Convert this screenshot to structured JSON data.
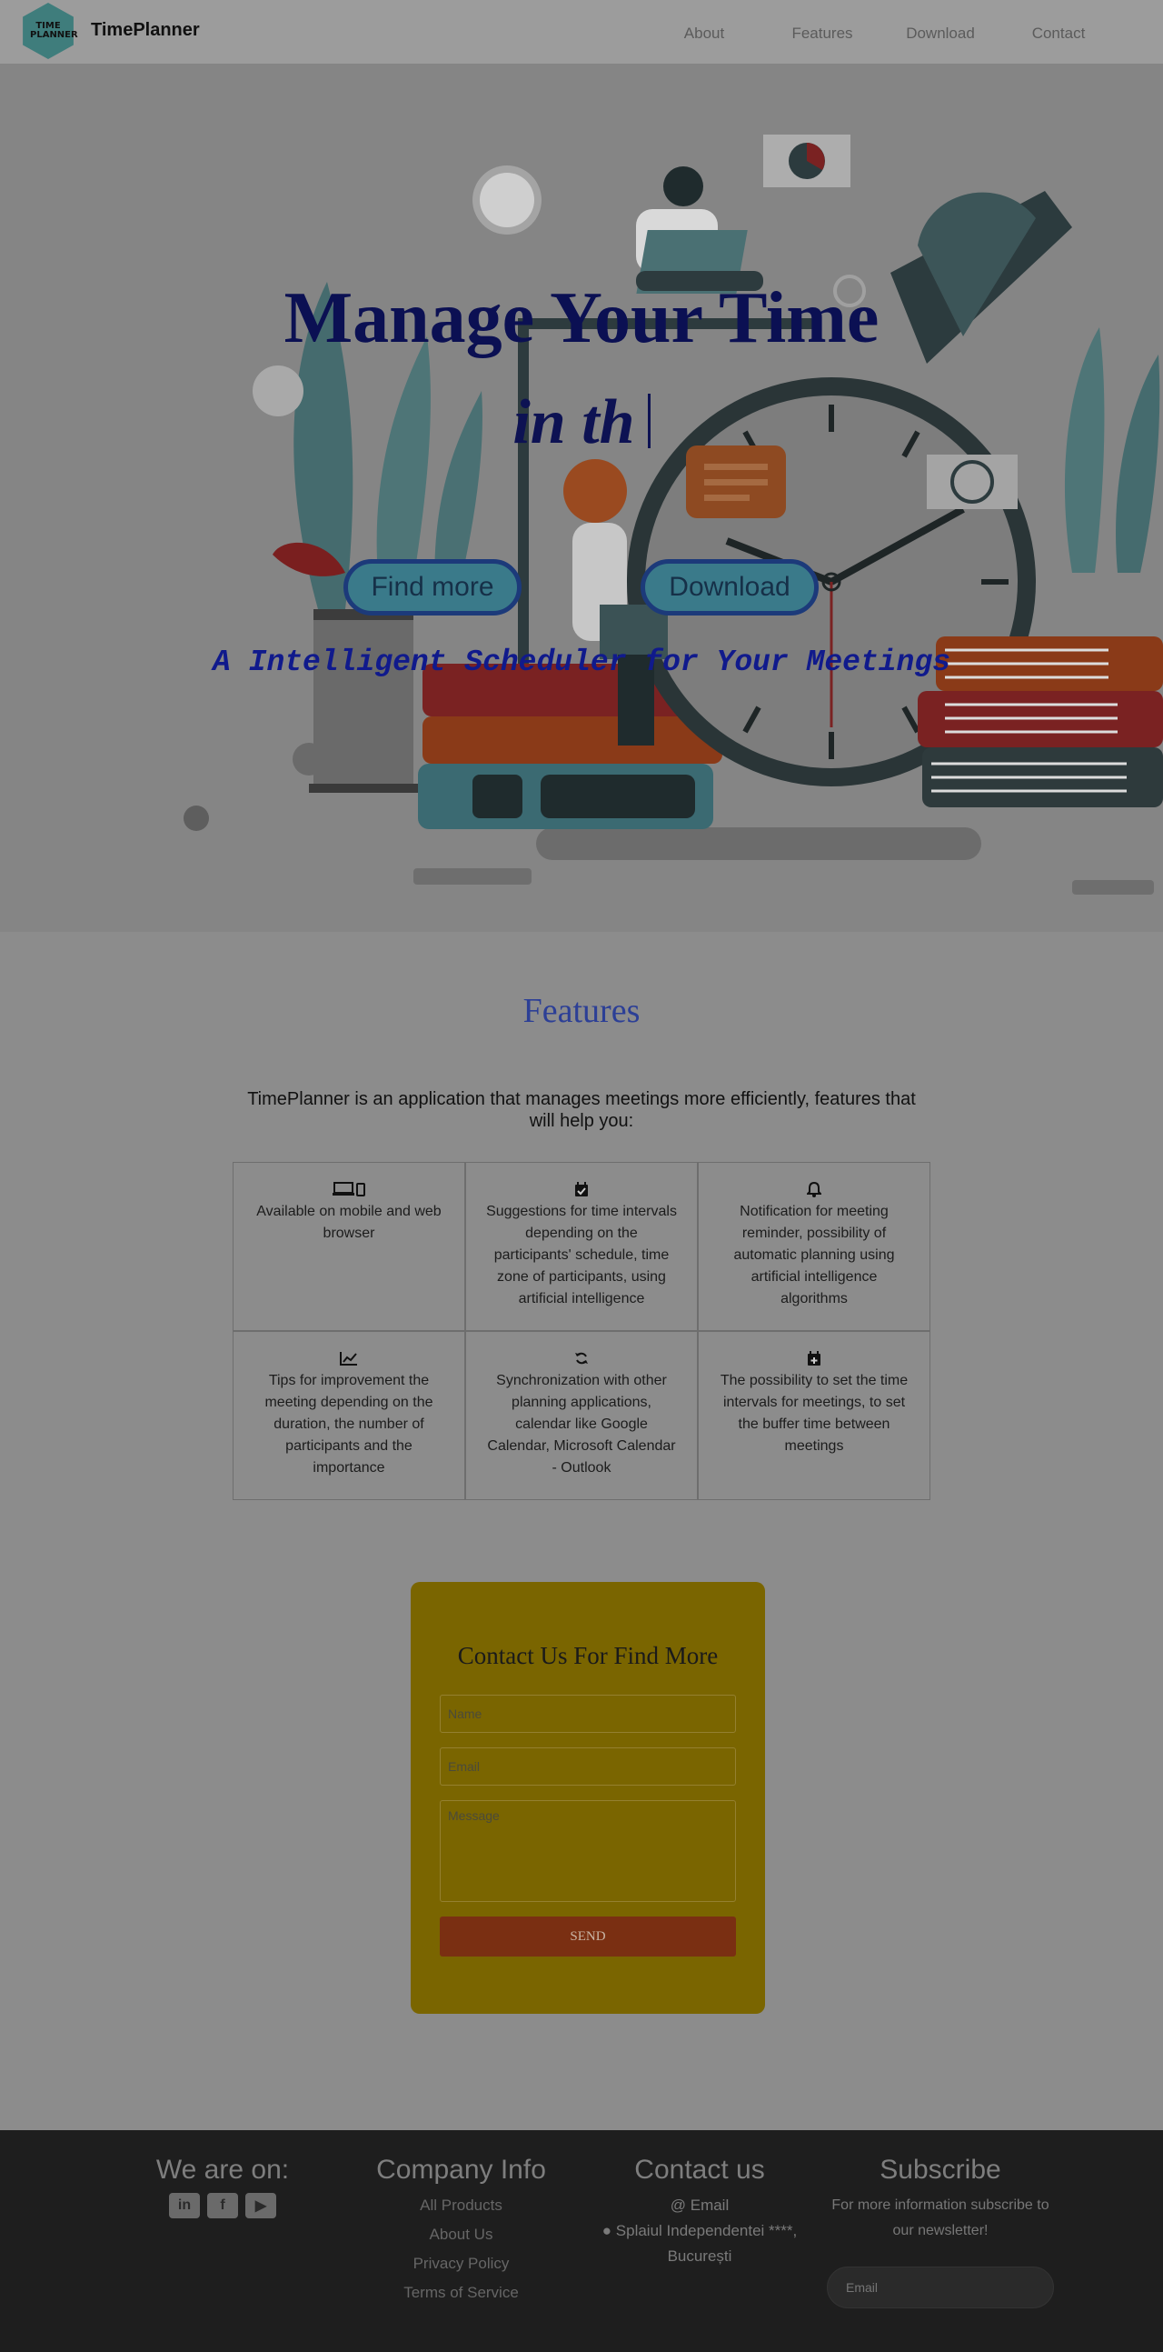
{
  "nav": {
    "logo_text": "TIME PLANNER",
    "brand": "TimePlanner",
    "links": [
      "About",
      "Features",
      "Download",
      "Contact"
    ]
  },
  "hero": {
    "title": "Manage Your Time",
    "typed": "in th",
    "buttons": {
      "find": "Find more",
      "download": "Download"
    },
    "subtitle": "A Intelligent Scheduler for Your Meetings"
  },
  "features": {
    "title": "Features",
    "intro": "TimePlanner is an application that manages meetings more efficiently, features that will help you:",
    "items": [
      {
        "icon": "devices-icon",
        "text": "Available on mobile and web browser"
      },
      {
        "icon": "calendar-check-icon",
        "text": "Suggestions for time intervals depending on the participants' schedule, time zone of participants, using artificial intelligence"
      },
      {
        "icon": "bell-icon",
        "text": "Notification for meeting reminder, possibility of automatic planning using artificial intelligence algorithms"
      },
      {
        "icon": "chart-line-icon",
        "text": "Tips for improvement the meeting depending on the duration, the number of participants and the importance"
      },
      {
        "icon": "sync-icon",
        "text": "Synchronization with other planning applications, calendar like Google Calendar, Microsoft Calendar - Outlook"
      },
      {
        "icon": "calendar-plus-icon",
        "text": "The possibility to set the time intervals for meetings, to set the buffer time between meetings"
      }
    ]
  },
  "contact": {
    "title": "Contact Us For Find More",
    "name_placeholder": "Name",
    "email_placeholder": "Email",
    "message_placeholder": "Message",
    "send_label": "SEND"
  },
  "footer": {
    "social_title": "We are on:",
    "social": [
      "in",
      "f",
      "▶"
    ],
    "company_title": "Company Info",
    "company_links": [
      "All Products",
      "About Us",
      "Privacy Policy",
      "Terms of Service"
    ],
    "contact_title": "Contact us",
    "contact_email": "@ Email",
    "contact_address_1": "Splaiul Independentei ****,",
    "contact_address_2": "București",
    "subscribe_title": "Subscribe",
    "subscribe_text": "For more information subscribe to our newsletter!",
    "subscribe_placeholder": "Email"
  }
}
